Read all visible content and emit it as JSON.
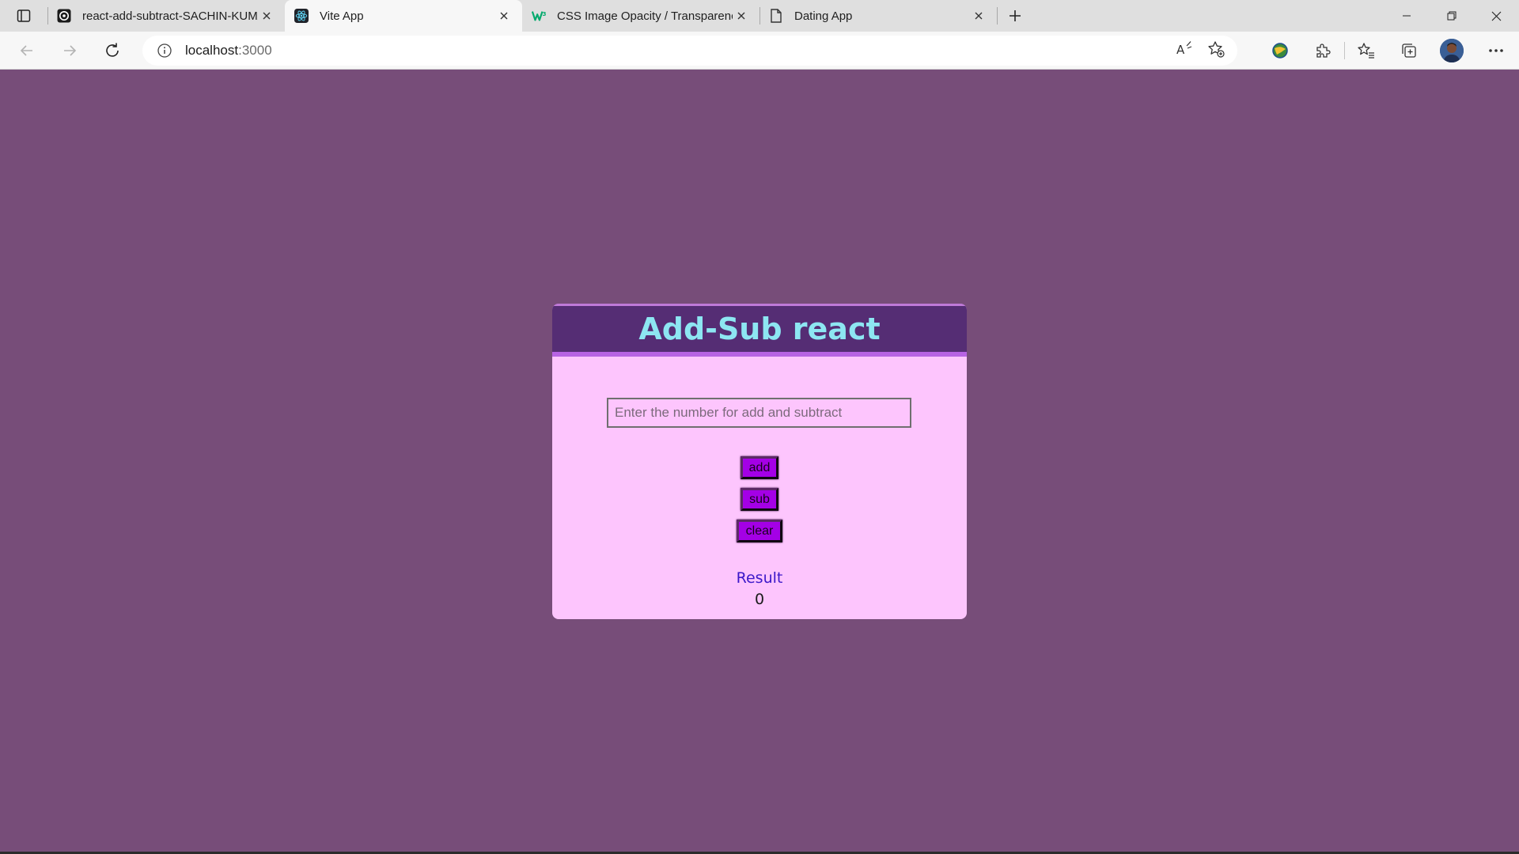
{
  "browser": {
    "tabs": [
      {
        "title": "react-add-subtract-SACHIN-KUMAR",
        "icon": "github-icon",
        "active": false
      },
      {
        "title": "Vite App",
        "icon": "react-icon",
        "active": true
      },
      {
        "title": "CSS Image Opacity / Transparency",
        "icon": "w3schools-icon",
        "active": false
      },
      {
        "title": "Dating App",
        "icon": "page-icon",
        "active": false
      }
    ],
    "address": {
      "host": "localhost",
      "port": ":3000"
    }
  },
  "app": {
    "title": "Add-Sub react",
    "input_placeholder": "Enter the number for add and subtract",
    "input_value": "",
    "buttons": {
      "add": "add",
      "sub": "sub",
      "clear": "clear"
    },
    "result_label": "Result",
    "result_value": "0"
  },
  "colors": {
    "page_background": "#774d79",
    "card_background": "#fdc5fd",
    "header_background": "#552d74",
    "title_color": "#8de6f2",
    "button_color": "#a400e6",
    "result_label_color": "#3b18c9"
  }
}
